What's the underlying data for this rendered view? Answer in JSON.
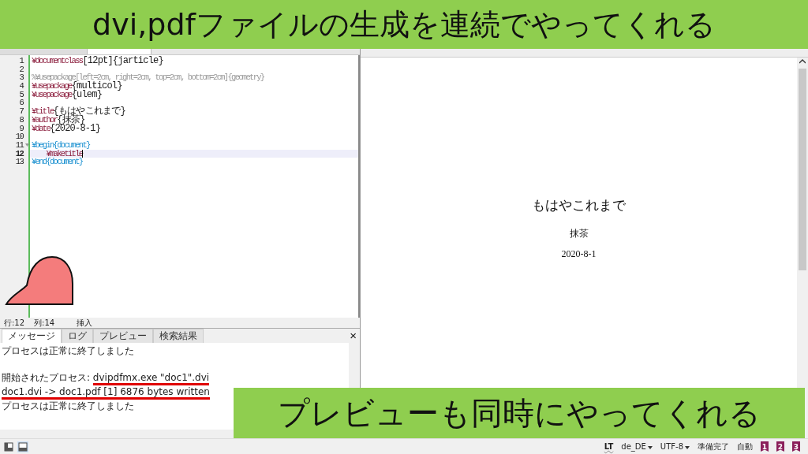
{
  "top_caption": "dvi,pdfファイルの生成を連続でやってくれる",
  "editor": {
    "lines": [
      {
        "number": "1",
        "current": false,
        "foldable": false,
        "segments": [
          {
            "text": "¥documentclass",
            "kind": "command"
          },
          {
            "text": "[12pt]{jarticle}",
            "kind": "plain"
          }
        ]
      },
      {
        "number": "2",
        "current": false,
        "foldable": false
      },
      {
        "number": "3",
        "current": false,
        "foldable": false,
        "segments": [
          {
            "text": "%¥usepackage[left=2cm, right=2cm, top=2cm, bottom=2cm]{geometry}",
            "kind": "comment"
          }
        ]
      },
      {
        "number": "4",
        "current": false,
        "foldable": false,
        "segments": [
          {
            "text": "¥usepackage",
            "kind": "command"
          },
          {
            "text": "{multicol}",
            "kind": "plain"
          }
        ]
      },
      {
        "number": "5",
        "current": false,
        "foldable": false,
        "segments": [
          {
            "text": "¥usepackage",
            "kind": "command"
          },
          {
            "text": "{ulem}",
            "kind": "plain"
          }
        ]
      },
      {
        "number": "6",
        "current": false,
        "foldable": false
      },
      {
        "number": "7",
        "current": false,
        "foldable": false,
        "segments": [
          {
            "text": "¥title",
            "kind": "command"
          },
          {
            "text": "{もはやこれまで}",
            "kind": "plain"
          }
        ]
      },
      {
        "number": "8",
        "current": false,
        "foldable": false,
        "segments": [
          {
            "text": "¥author",
            "kind": "command"
          },
          {
            "text": "{抹茶}",
            "kind": "plain"
          }
        ]
      },
      {
        "number": "9",
        "current": false,
        "foldable": false,
        "segments": [
          {
            "text": "¥date",
            "kind": "command"
          },
          {
            "text": "{2020-8-1}",
            "kind": "plain"
          }
        ]
      },
      {
        "number": "10",
        "current": false,
        "foldable": false
      },
      {
        "number": "11",
        "current": false,
        "foldable": true,
        "segments": [
          {
            "text": "¥begin{document}",
            "kind": "environment"
          }
        ]
      },
      {
        "number": "12",
        "current": true,
        "foldable": false,
        "segments": [
          {
            "text": "    ¥maketitle",
            "kind": "command"
          }
        ]
      },
      {
        "number": "13",
        "current": false,
        "foldable": false,
        "segments": [
          {
            "text": "¥end{document}",
            "kind": "environment"
          }
        ]
      }
    ]
  },
  "editor_status": {
    "line": "行:12",
    "column": "列:14",
    "mode": "挿入"
  },
  "messages": {
    "tabs": [
      {
        "label": "メッセージ",
        "selected": true
      },
      {
        "label": "ログ",
        "selected": false
      },
      {
        "label": "プレビュー",
        "selected": false
      },
      {
        "label": "検索結果",
        "selected": false
      }
    ],
    "close": "×",
    "lines": [
      {
        "segments": [
          {
            "text": "プロセスは正常に終了しました",
            "underlined": false
          }
        ]
      },
      {
        "segments": [
          {
            "text": "開始されたプロセス: ",
            "underlined": false
          },
          {
            "text": "dvipdfmx.exe \"doc1\".dvi",
            "underlined": true
          }
        ]
      },
      {
        "segments": [
          {
            "text": "doc1.dvi -> doc1.pdf [1] 6876 bytes written",
            "underlined": true
          }
        ]
      },
      {
        "segments": [
          {
            "text": "プロセスは正常に終了しました",
            "underlined": false
          }
        ]
      }
    ]
  },
  "viewer": {
    "title": "もはやこれまで",
    "author": "抹茶",
    "date": "2020-8-1"
  },
  "bottom_caption": "プレビューも同時にやってくれる",
  "status_bar": {
    "items": [
      {
        "kind": "language_tool",
        "text": "LT"
      },
      {
        "kind": "dropdown",
        "text": "de_DE"
      },
      {
        "kind": "dropdown",
        "text": "UTF-8"
      },
      {
        "kind": "label",
        "text": "準備完了"
      },
      {
        "kind": "label",
        "text": "自動"
      },
      {
        "kind": "bookmark",
        "text": "1"
      },
      {
        "kind": "bookmark",
        "text": "2"
      },
      {
        "kind": "bookmark",
        "text": "3"
      }
    ]
  }
}
